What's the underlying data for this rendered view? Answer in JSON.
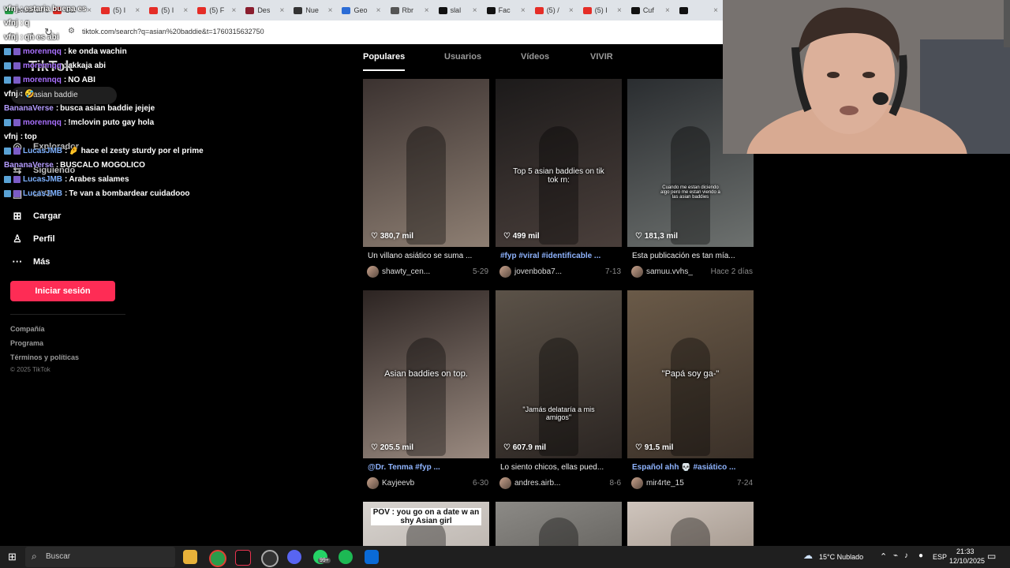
{
  "browser": {
    "tabs": [
      {
        "label": "ensal un in",
        "icon": "twitch-icon",
        "color": "#26a34a"
      },
      {
        "label": "Cuf",
        "icon": "youtube-icon",
        "color": "#e52d27"
      },
      {
        "label": "(5) I",
        "icon": "youtube-icon",
        "color": "#e52d27"
      },
      {
        "label": "(5) I",
        "icon": "youtube-icon",
        "color": "#e52d27"
      },
      {
        "label": "(5) F",
        "icon": "youtube-icon",
        "color": "#e52d27"
      },
      {
        "label": "Des",
        "icon": "page-icon",
        "color": "#8a1e2e"
      },
      {
        "label": "Nue",
        "icon": "github-icon",
        "color": "#333333"
      },
      {
        "label": "Geo",
        "icon": "download-icon",
        "color": "#2b6cd6"
      },
      {
        "label": "Rbr",
        "icon": "page-icon",
        "color": "#555555"
      },
      {
        "label": "slal",
        "icon": "tiktok-icon",
        "color": "#111111"
      },
      {
        "label": "Fac",
        "icon": "tiktok-icon",
        "color": "#111111"
      },
      {
        "label": "(5) /",
        "icon": "youtube-icon",
        "color": "#e52d27"
      },
      {
        "label": "(5) I",
        "icon": "youtube-icon",
        "color": "#e52d27"
      },
      {
        "label": "Cuf",
        "icon": "tiktok-icon",
        "color": "#111111"
      },
      {
        "label": "",
        "icon": "tiktok-icon",
        "color": "#111111"
      }
    ],
    "tab_close": "×",
    "url": "tiktok.com/search?q=asian%20baddie&t=1760315632750",
    "nav": {
      "back": "←",
      "forward": "→",
      "reload": "↻"
    }
  },
  "sidebar": {
    "logo": "TikTok",
    "search_query": "asian baddie",
    "items": [
      {
        "label": "Explorador",
        "icon": "compass-icon",
        "glyph": "◎"
      },
      {
        "label": "Siguiendo",
        "icon": "following-icon",
        "glyph": "⇆"
      },
      {
        "label": "LIVE",
        "icon": "live-icon",
        "glyph": "▣"
      },
      {
        "label": "Cargar",
        "icon": "upload-icon",
        "glyph": "⊞"
      },
      {
        "label": "Perfil",
        "icon": "profile-icon",
        "glyph": "♙"
      },
      {
        "label": "Más",
        "icon": "more-icon",
        "glyph": "···"
      }
    ],
    "login_button": "Iniciar sesión",
    "footer": [
      "Compañía",
      "Programa",
      "Términos y políticas"
    ],
    "copyright": "© 2025 TikTok"
  },
  "chat": [
    {
      "user": "vfnj",
      "color": "#ffffff",
      "text": "estaria buena es",
      "badge": false
    },
    {
      "user": "vfnj",
      "color": "#ffffff",
      "text": "q",
      "badge": false
    },
    {
      "user": "vfnj",
      "color": "#ffffff",
      "text": "qn es abi",
      "badge": false
    },
    {
      "user": "morennqq",
      "color": "#a970ff",
      "text": "ke onda wachin",
      "badge": true
    },
    {
      "user": "morennqq",
      "color": "#a970ff",
      "text": "akkaja abi",
      "badge": true
    },
    {
      "user": "morennqq",
      "color": "#a970ff",
      "text": "NO ABI",
      "badge": true
    },
    {
      "user": "vfnj",
      "color": "#ffffff",
      "text": "🤣",
      "badge": false
    },
    {
      "user": "BananaVerse",
      "color": "#b59cff",
      "text": "busca asian baddie jejeje",
      "badge": false
    },
    {
      "user": "morennqq",
      "color": "#a970ff",
      "text": "!mclovin puto gay hola",
      "badge": true
    },
    {
      "user": "vfnj",
      "color": "#ffffff",
      "text": "top",
      "badge": false
    },
    {
      "user": "LucasJMB",
      "color": "#7fb2ff",
      "text": "🤌 hace el zesty sturdy por el prime",
      "badge": true
    },
    {
      "user": "BananaVerse",
      "color": "#b59cff",
      "text": "BUSCALO MOGOLICO",
      "badge": false
    },
    {
      "user": "LucasJMB",
      "color": "#7fb2ff",
      "text": "Arabes salames",
      "badge": true
    },
    {
      "user": "LucasJMB",
      "color": "#7fb2ff",
      "text": "Te van a bombardear cuidadooo",
      "badge": true
    }
  ],
  "main": {
    "tabs": [
      "Populares",
      "Usuarios",
      "Vídeos",
      "VIVIR"
    ],
    "active_tab": 0,
    "videos": [
      {
        "likes": "380,7 mil",
        "caption": "Un villano asiático se suma ...",
        "user": "shawty_cen...",
        "date": "5-29",
        "overlay": "",
        "tag": false,
        "tone": [
          "#3b3230",
          "#8e7f73"
        ]
      },
      {
        "likes": "499 mil",
        "caption": "#fyp #viral #identificable ...",
        "user": "jovenboba7...",
        "date": "7-13",
        "overlay": "Top 5 asian baddies on tik tok rn:",
        "tag": true,
        "tone": [
          "#1c1a1a",
          "#4a3f3b"
        ]
      },
      {
        "likes": "181,3 mil",
        "caption": "Esta publicación es tan mía...",
        "user": "samuu.vvhs_",
        "date": "Hace 2 días",
        "overlay": "Cuando me estan diciendo algo pero me estan viendo a las asian baddies",
        "tag": false,
        "tone": [
          "#2a2d30",
          "#6d716f"
        ]
      },
      {
        "likes": "205.5 mil",
        "caption": "@Dr. Tenma #fyp ...",
        "user": "Kayjeevb",
        "date": "6-30",
        "overlay": "Asian baddies on top.",
        "tag": true,
        "tone": [
          "#2c2422",
          "#9a8a80"
        ]
      },
      {
        "likes": "607.9 mil",
        "caption": "Lo siento chicos, ellas pued...",
        "user": "andres.airb...",
        "date": "8-6",
        "overlay": "\"Jamás delataría a mis amigos\"",
        "tag": false,
        "tone": [
          "#5b5248",
          "#2b2522"
        ]
      },
      {
        "likes": "91.5 mil",
        "caption": "Español ahh 💀 #asiático ...",
        "user": "mir4rte_15",
        "date": "7-24",
        "overlay": "\"Papá soy ga-\"",
        "tag": true,
        "tone": [
          "#6a5a48",
          "#3a3028"
        ]
      },
      {
        "likes": "",
        "caption": "",
        "user": "",
        "date": "",
        "overlay": "POV : you go on a date w an shy Asian girl",
        "tag": false,
        "tone": [
          "#d8d4d0",
          "#bfb8b2"
        ]
      },
      {
        "likes": "",
        "caption": "",
        "user": "",
        "date": "",
        "overlay": "",
        "tag": false,
        "tone": [
          "#8c8a86",
          "#6a6864"
        ]
      },
      {
        "likes": "",
        "caption": "",
        "user": "",
        "date": "",
        "overlay": "",
        "tag": false,
        "tone": [
          "#cfc5bd",
          "#a89c92"
        ]
      }
    ]
  },
  "taskbar": {
    "search_placeholder": "Buscar",
    "weather": "15°C  Nublado",
    "lang": "ESP",
    "time": "21:33",
    "date": "12/10/2025",
    "notif_badge": "99+"
  },
  "colors": {
    "accent": "#fe2c55",
    "hashtag": "#8fb4ff"
  }
}
